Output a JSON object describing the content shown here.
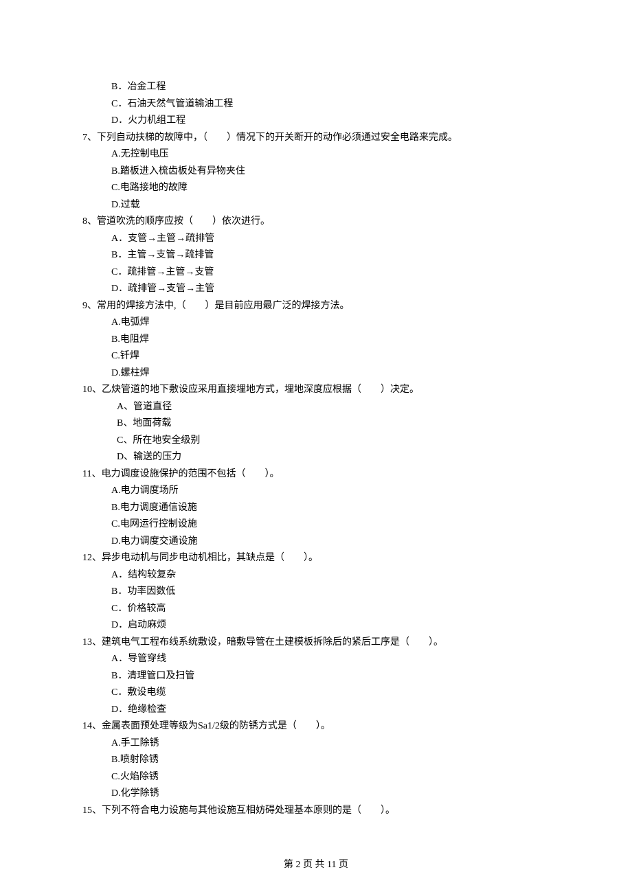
{
  "q6": {
    "optB": "B．冶金工程",
    "optC": "C．石油天然气管道输油工程",
    "optD": "D．火力机组工程"
  },
  "q7": {
    "stem": "7、下列自动扶梯的故障中，（　　）情况下的开关断开的动作必须通过安全电路来完成。",
    "optA": "A.无控制电压",
    "optB": "B.踏板进入梳齿板处有异物夹住",
    "optC": "C.电路接地的故障",
    "optD": "D.过载"
  },
  "q8": {
    "stem": "8、管道吹洗的顺序应按（　　）依次进行。",
    "optA": "A．支管→主管→疏排管",
    "optB": "B．主管→支管→疏排管",
    "optC": "C．疏排管→主管→支管",
    "optD": "D．疏排管→支管→主管"
  },
  "q9": {
    "stem": "9、常用的焊接方法中,（　　）是目前应用最广泛的焊接方法。",
    "optA": "A.电弧焊",
    "optB": "B.电阻焊",
    "optC": "C.钎焊",
    "optD": "D.螺柱焊"
  },
  "q10": {
    "stem": "10、乙炔管道的地下敷设应采用直接埋地方式，埋地深度应根据（　　）决定。",
    "optA": "A、管道直径",
    "optB": "B、地面荷载",
    "optC": "C、所在地安全级别",
    "optD": "D、输送的压力"
  },
  "q11": {
    "stem": "11、电力调度设施保护的范围不包括（　　）。",
    "optA": "A.电力调度场所",
    "optB": "B.电力调度通信设施",
    "optC": "C.电网运行控制设施",
    "optD": "D.电力调度交通设施"
  },
  "q12": {
    "stem": "12、异步电动机与同步电动机相比，其缺点是（　　）。",
    "optA": "A．结构较复杂",
    "optB": "B．功率因数低",
    "optC": "C．价格较高",
    "optD": "D．启动麻烦"
  },
  "q13": {
    "stem": "13、建筑电气工程布线系统敷设，暗敷导管在土建模板拆除后的紧后工序是（　　）。",
    "optA": "A．导管穿线",
    "optB": "B．清理管口及扫管",
    "optC": "C．敷设电缆",
    "optD": "D．绝缘检查"
  },
  "q14": {
    "stem": "14、金属表面预处理等级为Sa1/2级的防锈方式是（　　）。",
    "optA": "A.手工除锈",
    "optB": "B.喷射除锈",
    "optC": "C.火焰除锈",
    "optD": "D.化学除锈"
  },
  "q15": {
    "stem": "15、下列不符合电力设施与其他设施互相妨碍处理基本原则的是（　　）。"
  },
  "footer": "第 2 页 共 11 页"
}
